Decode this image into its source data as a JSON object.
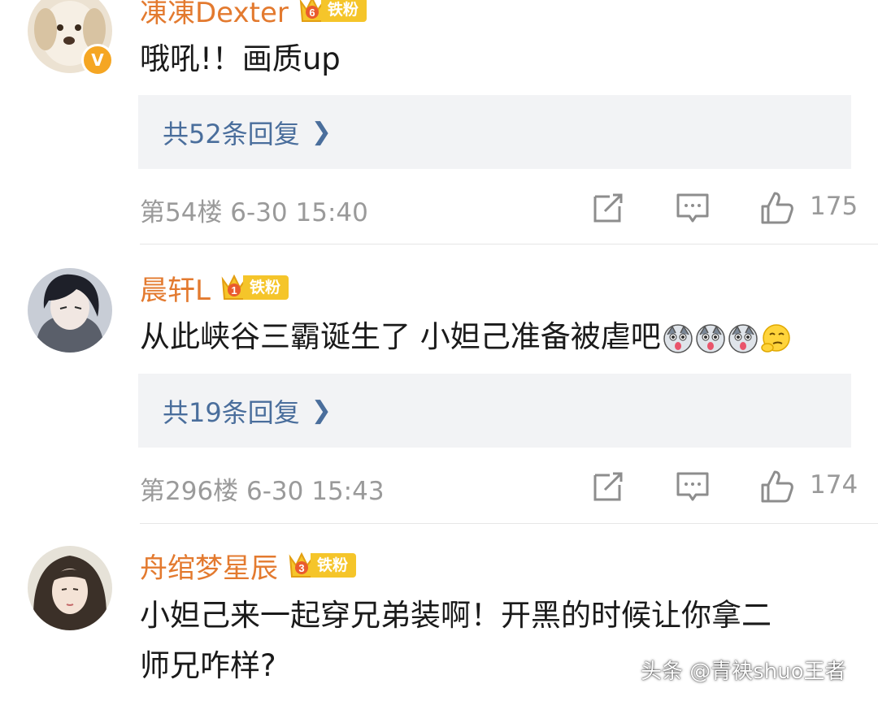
{
  "comments": [
    {
      "username": "凍凍Dexter",
      "fan_label": "铁粉",
      "fan_level": "6",
      "verified_badge": "V",
      "text": "哦吼!！画质up",
      "reply_label": "共52条回复",
      "floor_time": "第54楼 6-30 15:40",
      "likes": "175"
    },
    {
      "username": "晨轩L",
      "fan_label": "铁粉",
      "fan_level": "1",
      "text": "从此峡谷三霸诞生了 小妲己准备被虐吧",
      "emojis": [
        "husky-emoji",
        "husky-emoji",
        "husky-emoji",
        "thinking-emoji"
      ],
      "reply_label": "共19条回复",
      "floor_time": "第296楼 6-30 15:43",
      "likes": "174"
    },
    {
      "username": "舟绾梦星辰",
      "fan_label": "铁粉",
      "fan_level": "3",
      "text_line1": "小妲己来一起穿兄弟装啊！开黑的时候让你拿二",
      "text_line2": "师兄咋样?"
    }
  ],
  "icons": {
    "reply_chevron": "chevron-right-icon",
    "repost": "repost-icon",
    "comment": "comment-icon",
    "like": "thumbs-up-icon"
  },
  "watermark": "头条 @青袂shuo王者",
  "colors": {
    "username": "#e37a2f",
    "reply_link": "#4a6e9c",
    "reply_bg": "#f2f3f5",
    "meta": "#9a9a9a",
    "fan_badge": "#f5c52a"
  }
}
